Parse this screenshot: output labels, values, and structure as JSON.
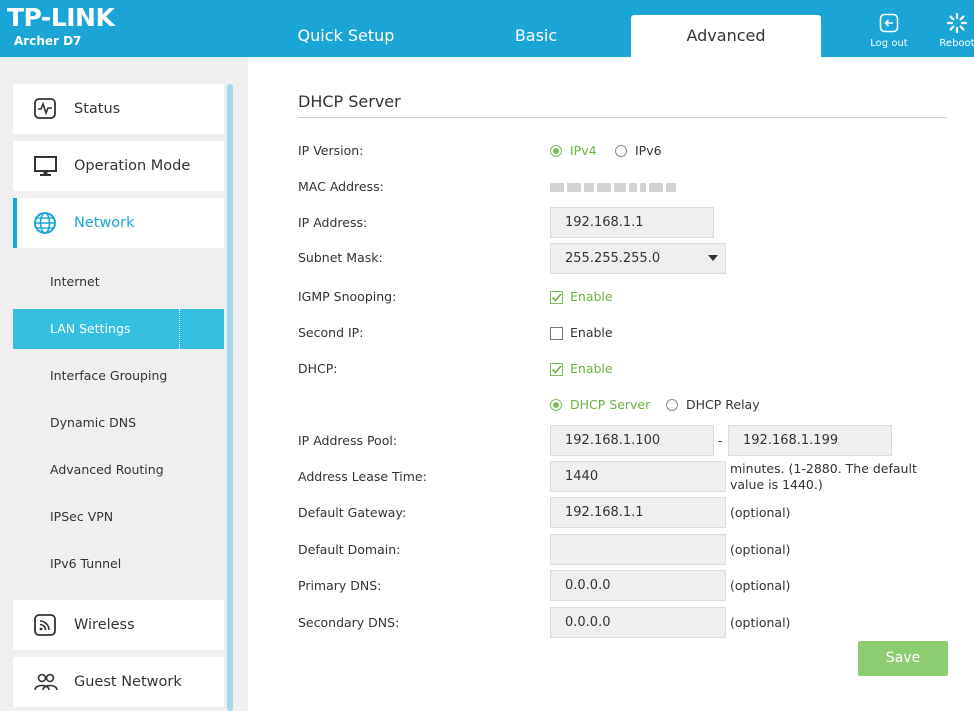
{
  "header": {
    "brand": "TP-LINK",
    "model": "Archer D7",
    "tabs": [
      {
        "label": "Quick Setup"
      },
      {
        "label": "Basic"
      },
      {
        "label": "Advanced"
      }
    ],
    "logout_label": "Log out",
    "reboot_label": "Reboot",
    "accent": "#1aa5d6"
  },
  "sidebar": {
    "main_items": [
      {
        "label": "Status",
        "icon": "pulse-icon"
      },
      {
        "label": "Operation Mode",
        "icon": "monitor-icon"
      },
      {
        "label": "Network",
        "icon": "globe-icon",
        "active": true
      },
      {
        "label": "Wireless",
        "icon": "wifi-icon"
      },
      {
        "label": "Guest Network",
        "icon": "guests-icon"
      }
    ],
    "sub_items": [
      {
        "label": "Internet"
      },
      {
        "label": "LAN Settings",
        "active": true
      },
      {
        "label": "Interface Grouping"
      },
      {
        "label": "Dynamic DNS"
      },
      {
        "label": "Advanced Routing"
      },
      {
        "label": "IPSec VPN"
      },
      {
        "label": "IPv6 Tunnel"
      }
    ]
  },
  "main": {
    "title": "DHCP Server",
    "ip_version": {
      "label": "IP Version:",
      "options": [
        {
          "label": "IPv4",
          "selected": true
        },
        {
          "label": "IPv6",
          "selected": false
        }
      ]
    },
    "mac_address": {
      "label": "MAC Address:"
    },
    "ip_address": {
      "label": "IP Address:",
      "value": "192.168.1.1"
    },
    "subnet_mask": {
      "label": "Subnet Mask:",
      "value": "255.255.255.0"
    },
    "igmp_snooping": {
      "label": "IGMP Snooping:",
      "option": "Enable",
      "checked": true
    },
    "second_ip": {
      "label": "Second IP:",
      "option": "Enable",
      "checked": false
    },
    "dhcp": {
      "label": "DHCP:",
      "option": "Enable",
      "checked": true
    },
    "dhcp_mode": {
      "options": [
        {
          "label": "DHCP Server",
          "selected": true
        },
        {
          "label": "DHCP Relay",
          "selected": false
        }
      ]
    },
    "ip_pool": {
      "label": "IP Address Pool:",
      "start": "192.168.1.100",
      "separator": "-",
      "end": "192.168.1.199"
    },
    "lease_time": {
      "label": "Address Lease Time:",
      "value": "1440",
      "hint_line1": "minutes. (1-2880. The default",
      "hint_line2": "value is 1440.)"
    },
    "default_gateway": {
      "label": "Default Gateway:",
      "value": "192.168.1.1",
      "hint": "(optional)"
    },
    "default_domain": {
      "label": "Default Domain:",
      "value": "",
      "hint": "(optional)"
    },
    "primary_dns": {
      "label": "Primary DNS:",
      "value": "0.0.0.0",
      "hint": "(optional)"
    },
    "secondary_dns": {
      "label": "Secondary DNS:",
      "value": "0.0.0.0",
      "hint": "(optional)"
    },
    "save_label": "Save"
  }
}
